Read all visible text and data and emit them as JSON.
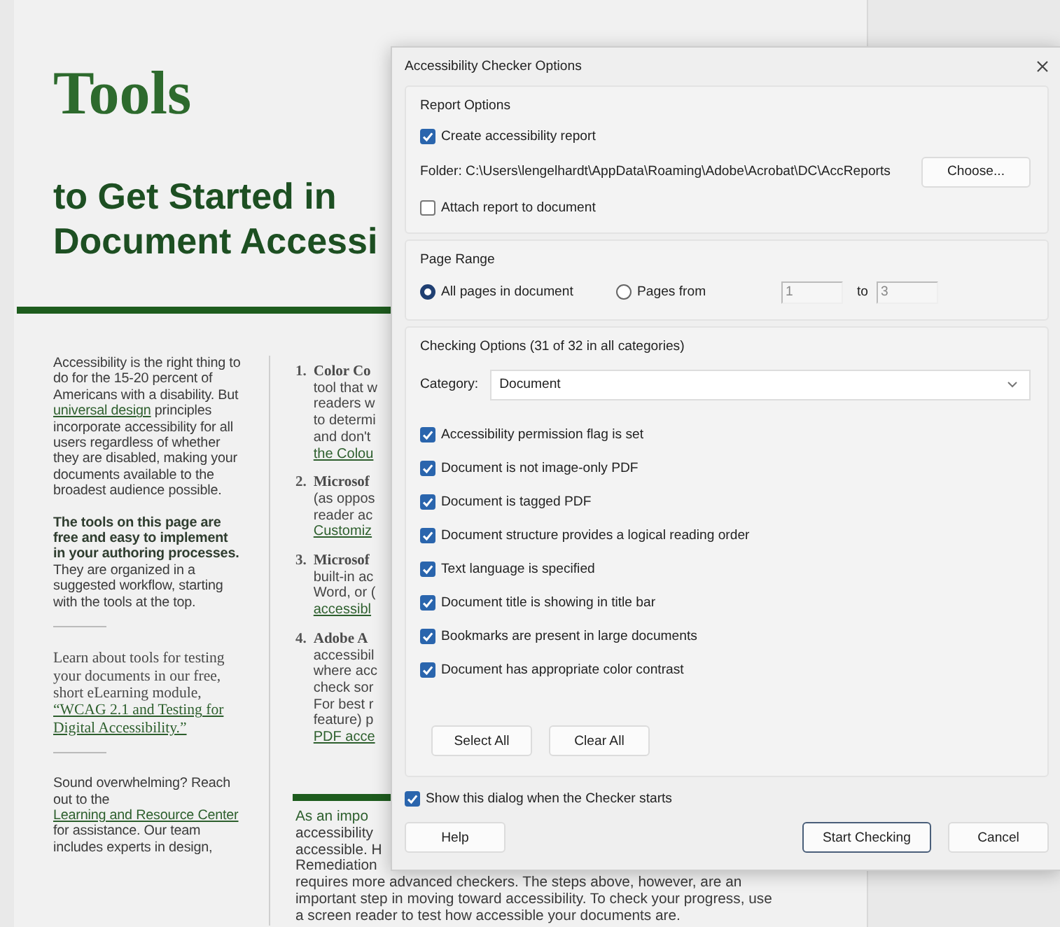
{
  "document": {
    "title": "Tools",
    "subtitle_lines": [
      "to Get Started in",
      "Document Accessi"
    ],
    "sidebar": [
      {
        "kind": "paragraph-sans",
        "segments": [
          {
            "kind": "plain",
            "text": "Accessibility is the right thing to do for the 15-20 percent of Americans with a disability. But "
          },
          {
            "kind": "link",
            "text": "universal design"
          },
          {
            "kind": "plain",
            "text": " principles incorporate accessibility for all users regardless of whether they are disabled, making your documents available to the broadest audience possible."
          }
        ]
      },
      {
        "kind": "paragraph-sans",
        "segments": [
          {
            "kind": "bold",
            "text": "The tools on this page are free and easy to implement in your authoring processes."
          },
          {
            "kind": "plain",
            "text": " They are organized in a suggested workflow, starting with the tools at the top."
          }
        ]
      },
      {
        "kind": "rule"
      },
      {
        "kind": "paragraph-serif",
        "segments": [
          {
            "kind": "plain",
            "text": "Learn about tools for testing your documents in our free, short eLearning module, "
          },
          {
            "kind": "link",
            "text": "“WCAG 2.1 and Testing for Digital Accessibility.”"
          }
        ]
      },
      {
        "kind": "rule"
      },
      {
        "kind": "paragraph-sans",
        "segments": [
          {
            "kind": "plain",
            "text": "Sound overwhelming? Reach out to the "
          },
          {
            "kind": "link",
            "text": "Learning and Resource Center"
          },
          {
            "kind": "plain",
            "text": " for assistance. Our team includes experts in design,"
          }
        ]
      }
    ],
    "list": [
      {
        "number": "1.",
        "title": "Color Co",
        "lines": [
          "tool that w",
          "readers w",
          "to determi",
          "and don't"
        ],
        "link": "the Colou"
      },
      {
        "number": "2.",
        "title": "Microsof",
        "lines": [
          "(as oppos",
          "reader ac"
        ],
        "link": "Customiz"
      },
      {
        "number": "3.",
        "title": "Microsof",
        "lines": [
          "built-in ac",
          "Word, or ("
        ],
        "link": "accessibl"
      },
      {
        "number": "4.",
        "title": "Adobe A",
        "lines": [
          "accessibil",
          "where acc",
          "check sor",
          "For best r",
          "feature) p"
        ],
        "link": "PDF acce"
      }
    ],
    "closing_lines": [
      "As an impo",
      "accessibility",
      "accessible. H",
      "Remediation",
      "requires more advanced checkers. The steps above, however, are an",
      "important step in moving toward accessibility. To check your progress, use",
      "a screen reader to test how accessible your documents are."
    ]
  },
  "dialog": {
    "title": "Accessibility Checker Options",
    "report_options": {
      "label": "Report Options",
      "create_report": {
        "label": "Create accessibility report",
        "checked": true
      },
      "folder": "Folder: C:\\Users\\lengelhardt\\AppData\\Roaming\\Adobe\\Acrobat\\DC\\AccReports",
      "choose_button": "Choose...",
      "attach_report": {
        "label": "Attach report to document",
        "checked": false
      }
    },
    "page_range": {
      "label": "Page Range",
      "options": [
        {
          "label": "All pages in document",
          "selected": true
        },
        {
          "label": "Pages from",
          "selected": false
        }
      ],
      "from": "1",
      "to_label": "to",
      "to": "3"
    },
    "checking_options": {
      "label": "Checking Options (31 of 32 in all categories)",
      "category_label": "Category:",
      "category": "Document",
      "checks": [
        {
          "label": "Accessibility permission flag is set",
          "checked": true
        },
        {
          "label": "Document is not image-only PDF",
          "checked": true
        },
        {
          "label": "Document is tagged PDF",
          "checked": true
        },
        {
          "label": "Document structure provides a logical reading order",
          "checked": true
        },
        {
          "label": "Text language is specified",
          "checked": true
        },
        {
          "label": "Document title is showing in title bar",
          "checked": true
        },
        {
          "label": "Bookmarks are present in large documents",
          "checked": true
        },
        {
          "label": "Document has appropriate color contrast",
          "checked": true
        }
      ],
      "buttons": [
        "Select All",
        "Clear All"
      ]
    },
    "show_dialog": {
      "label": "Show this dialog when the Checker starts",
      "checked": true
    },
    "left_buttons": [
      {
        "label": "Help",
        "default": false
      }
    ],
    "right_buttons": [
      {
        "label": "Start Checking",
        "default": true
      },
      {
        "label": "Cancel",
        "default": false
      }
    ]
  }
}
